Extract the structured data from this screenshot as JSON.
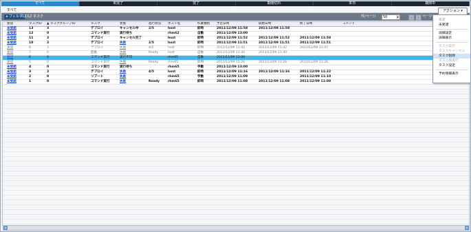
{
  "tabs": [
    {
      "label": "すべて",
      "active": true
    },
    {
      "label": "未完了",
      "active": false
    },
    {
      "label": "完了",
      "active": false
    },
    {
      "label": "期限切れ",
      "active": false
    },
    {
      "label": "本日",
      "active": false
    },
    {
      "label": "期限中",
      "active": false
    }
  ],
  "subtitle": "すべて",
  "filter": {
    "button": "▸ フィルタ",
    "count": "12/12 タスク"
  },
  "paging": {
    "per_page_label": "件/ページ",
    "per_page_value": "50",
    "page_label": "ページ",
    "prev": "‹",
    "next": "›"
  },
  "action_button": "アクション ▾",
  "columns": [
    "受諾",
    "タスクID",
    "▲ タスクグループID",
    "タスク",
    "状態",
    "進行状況",
    "ホスト名",
    "作業種別",
    "予定日時",
    "開始日時",
    "終了日時",
    "コメント"
  ],
  "rows": [
    {
      "style": "bold",
      "cells": [
        "未受諾",
        "13",
        "3",
        "デプロイ",
        "キャンセル中",
        "2/5",
        "host",
        "即時",
        "2011/12/09 11:58",
        "2011/12/09 11:58",
        "",
        ""
      ]
    },
    {
      "style": "bold",
      "cells": [
        "未受諾",
        "12",
        "0",
        "コマンド実行",
        "実行待ち",
        "",
        "rhm62",
        "自動",
        "2011/12/09 13:00",
        "",
        "",
        ""
      ]
    },
    {
      "style": "bold",
      "cells": [
        "未受諾",
        "11",
        "3",
        "デプロイ",
        "キャンセル完了",
        "",
        "host",
        "即時",
        "2011/12/09 11:52",
        "2011/12/09 11:52",
        "2011/12/09 11:58",
        ""
      ]
    },
    {
      "style": "bold",
      "cells": [
        "未受諾",
        "10",
        "3",
        "デプロイ",
        "失敗",
        "2/5",
        "host",
        "即時",
        "2011/12/09 11:51",
        "2011/12/09 11:51",
        "2011/12/09 11:51",
        ""
      ]
    },
    {
      "style": "gray",
      "cells": [
        "受諾",
        "8",
        "3",
        "デプロイ",
        "失敗",
        "4/5",
        "host",
        "即時",
        "2011/12/09 11:42",
        "2011/12/09 11:42",
        "2011/12/09 11:47",
        ""
      ]
    },
    {
      "style": "gray",
      "cells": [
        "受諾",
        "7",
        "0",
        "起動",
        "失敗",
        "Ready",
        "host",
        "自動",
        "2011/12/09 11:40",
        "2011/12/09 11:40",
        "",
        ""
      ]
    },
    {
      "style": "sel",
      "cells": [
        "受諾",
        "6",
        "0",
        "コマンド実行",
        "実行不可",
        "",
        "rhm65",
        "自動",
        "2011/12/09 12:00",
        "",
        "",
        ""
      ]
    },
    {
      "style": "gray",
      "cells": [
        "受諾",
        "5",
        "0",
        "コマンド実行",
        "失敗",
        "Ready",
        "rhm65",
        "即時",
        "2011/12/09 11:26",
        "2011/12/09 11:26",
        "2011/12/09 11:26",
        ""
      ]
    },
    {
      "style": "bold",
      "cells": [
        "未受諾",
        "4",
        "0",
        "コマンド実行",
        "実行待ち",
        "",
        "rhm65",
        "手動",
        "2011/12/09 13:00",
        "",
        "",
        ""
      ]
    },
    {
      "style": "bold",
      "cells": [
        "未受諾",
        "3",
        "3",
        "デプロイ",
        "失敗",
        "4/5",
        "host",
        "即時",
        "2011/12/09 11:16",
        "2011/12/09 11:16",
        "2011/12/09 11:22",
        ""
      ]
    },
    {
      "style": "bold",
      "cells": [
        "未受諾",
        "2",
        "0",
        "リブート",
        "失敗",
        "",
        "rhm65",
        "手動",
        "2011/12/09 11:09",
        "",
        "2011/12/09 11:10",
        ""
      ]
    },
    {
      "style": "bold",
      "cells": [
        "未受諾",
        "1",
        "0",
        "コマンド実行",
        "失敗",
        "Ready",
        "rhm65",
        "即時",
        "2011/12/09 11:08",
        "2011/12/09 11:08",
        "2011/12/09 11:08",
        ""
      ]
    }
  ],
  "menu": [
    {
      "label": "受諾",
      "disabled": true,
      "highlight": false
    },
    {
      "label": "未受諾",
      "disabled": false,
      "highlight": false
    },
    {
      "sep": true
    },
    {
      "label": "詳細設定",
      "disabled": false,
      "highlight": false
    },
    {
      "label": "詳細表示",
      "disabled": false,
      "highlight": false
    },
    {
      "sep": true
    },
    {
      "label": "タスク実行",
      "disabled": true,
      "highlight": false
    },
    {
      "label": "タスクキャンセル",
      "disabled": true,
      "highlight": false
    },
    {
      "label": "タスク削除",
      "disabled": false,
      "highlight": true
    },
    {
      "label": "タスク再実行",
      "disabled": true,
      "highlight": false
    },
    {
      "label": "タスク設定",
      "disabled": false,
      "highlight": false
    },
    {
      "sep": true
    },
    {
      "label": "予約情報表示",
      "disabled": false,
      "highlight": false
    }
  ],
  "scroll": {
    "left": "◂",
    "right": "▸"
  }
}
